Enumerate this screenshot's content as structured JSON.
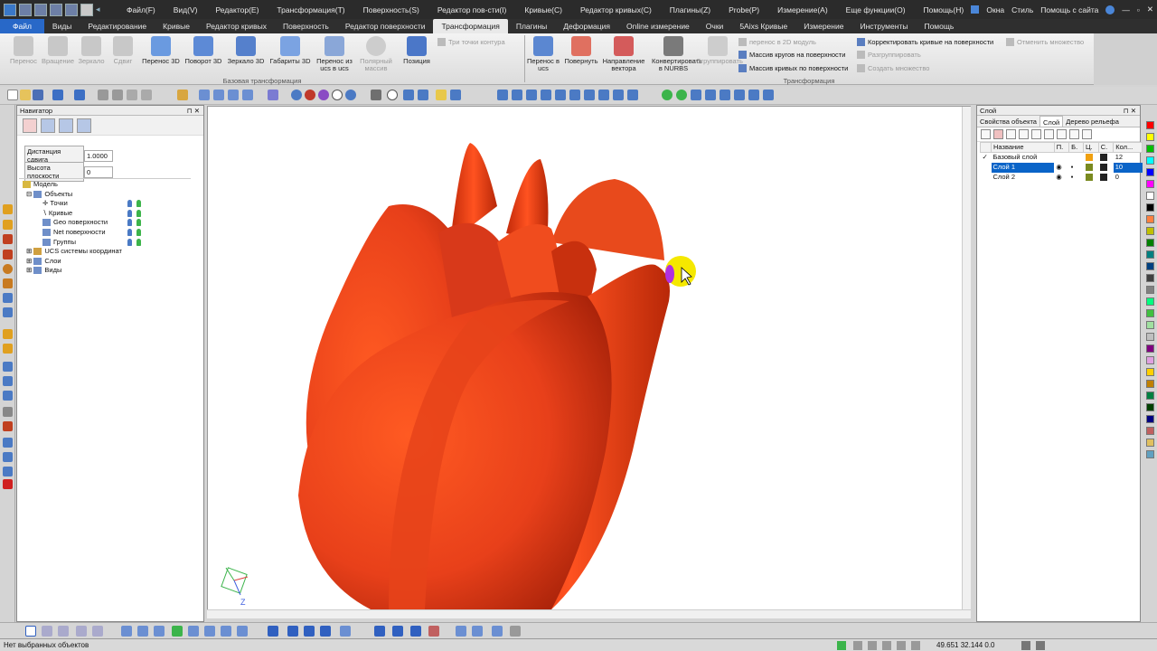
{
  "menu": {
    "items": [
      "Файл(F)",
      "Вид(V)",
      "Редактор(E)",
      "Трансформация(T)",
      "Поверхность(S)",
      "Редактор пов-сти(I)",
      "Кривые(C)",
      "Редактор кривых(C)",
      "Плагины(Z)",
      "Probe(P)",
      "Измерение(A)",
      "Еще функции(O)",
      "Помощь(H)"
    ],
    "right": [
      "Окна",
      "Стиль",
      "Помощь с сайта"
    ]
  },
  "ribbon_tabs": {
    "file": "Файл",
    "items": [
      "Виды",
      "Редактирование",
      "Кривые",
      "Редактор кривых",
      "Поверхность",
      "Редактор поверхности",
      "Трансформация",
      "Плагины",
      "Деформация",
      "Online измерение",
      "Очки",
      "5Aixs Кривые",
      "Измерение",
      "Инструменты",
      "Помощь"
    ],
    "active": "Трансформация"
  },
  "ribbon": {
    "group1_label": "Базовая трансформация",
    "group2_label": "Трансформация",
    "b1": "Перенос",
    "b2": "Вращение",
    "b3": "Зеркало",
    "b4": "Сдвиг",
    "b5": "Перенос 3D",
    "b6": "Поворот 3D",
    "b7": "Зеркало 3D",
    "b8": "Габариты 3D",
    "b9": "Перенос из ucs в ucs",
    "b10": "Полярный массив",
    "b11": "Позиция",
    "b12": "Три точки контура",
    "b13": "Перенос в ucs",
    "b14": "Повернуть",
    "b15": "Направление вектора",
    "b16": "Конвертировать в NURBS",
    "b17": "Сгруппировать",
    "s1": "перенос в 2D модуль",
    "s2": "Массив кругов на поверхности",
    "s3": "Массив кривых по поверхности",
    "s4": "Корректировать кривые на поверхности",
    "s5": "Разгруппировать",
    "s6": "Создать множество",
    "s7": "Отменить множество"
  },
  "navigator": {
    "title": "Навигатор",
    "shift_label": "Дистанция сдвига",
    "shift_value": "1.0000",
    "height_label": "Высота плоскости",
    "height_value": "0",
    "tree": {
      "model": "Модель",
      "objects": "Объекты",
      "points": "Точки",
      "curves": "Кривые",
      "geo": "Geo поверхности",
      "net": "Net поверхности",
      "groups": "Группы",
      "ucs": "UCS системы координат",
      "layers": "Слои",
      "views": "Виды"
    }
  },
  "layers_panel": {
    "title": "Слой",
    "tabs": [
      "Свойства объекта",
      "Слой",
      "Дерево рельефа"
    ],
    "columns": {
      "name": "Название",
      "p": "П.",
      "b": "Б.",
      "c": "Ц.",
      "s": "С.",
      "count": "Кол..."
    },
    "rows": [
      {
        "name": "Базовый слой",
        "count": "12",
        "color": "#f0a010",
        "checked": true,
        "selected": false
      },
      {
        "name": "Слой 1",
        "count": "10",
        "color": "#7a8a20",
        "checked": false,
        "selected": true
      },
      {
        "name": "Слой 2",
        "count": "0",
        "color": "#7a8a20",
        "checked": false,
        "selected": false
      }
    ]
  },
  "colors": {
    "accent": "#2868c8",
    "tulip": "#e8401a",
    "palette": [
      "#ff0000",
      "#ffff00",
      "#00c000",
      "#00ffff",
      "#0000ff",
      "#ff00ff",
      "#ffffff",
      "#000000",
      "#ff8040",
      "#c0c000",
      "#008000",
      "#008080",
      "#004080",
      "#404040",
      "#808080",
      "#00ff80",
      "#40c040",
      "#a0e0a0",
      "#c0c0c0",
      "#800080",
      "#e0a0e0",
      "#ffd000",
      "#c08000",
      "#008040",
      "#004000",
      "#000080",
      "#c06060",
      "#e0c060",
      "#60a0c0"
    ]
  },
  "status": {
    "message": "Нет выбранных объектов",
    "coords": "49.651 32.144 0.0"
  },
  "axis": {
    "z": "Z"
  }
}
